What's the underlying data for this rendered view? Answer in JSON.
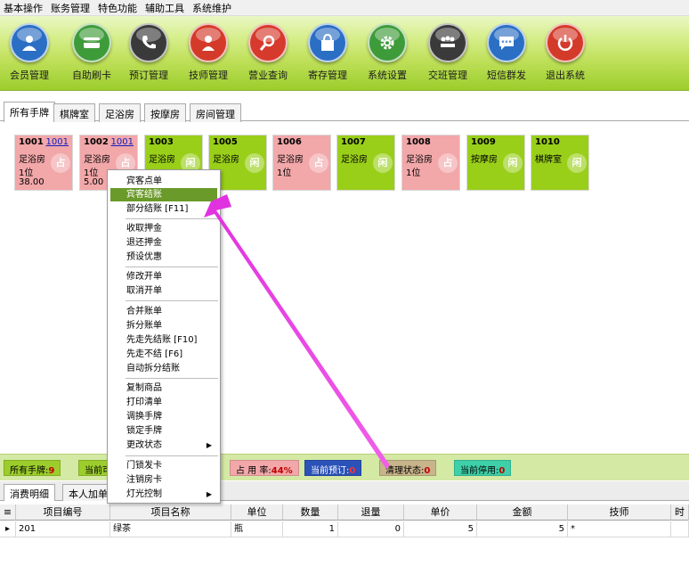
{
  "menubar": [
    "基本操作",
    "账务管理",
    "特色功能",
    "辅助工具",
    "系统维护"
  ],
  "toolbar": [
    {
      "label": "会员管理",
      "icon": "member-icon",
      "color": "#2b6fc4"
    },
    {
      "label": "自助刷卡",
      "icon": "card-icon",
      "color": "#3e9b3a"
    },
    {
      "label": "预订管理",
      "icon": "phone-icon",
      "color": "#3a3a3a"
    },
    {
      "label": "技师管理",
      "icon": "technician-icon",
      "color": "#d43a2a"
    },
    {
      "label": "营业查询",
      "icon": "magnifier-icon",
      "color": "#d63a2c"
    },
    {
      "label": "寄存管理",
      "icon": "bag-icon",
      "color": "#2b6fc4"
    },
    {
      "label": "系统设置",
      "icon": "gear-icon",
      "color": "#3e9b3a"
    },
    {
      "label": "交班管理",
      "icon": "meeting-icon",
      "color": "#3a3a3a"
    },
    {
      "label": "短信群发",
      "icon": "message-icon",
      "color": "#2b6fc4"
    },
    {
      "label": "退出系统",
      "icon": "power-icon",
      "color": "#d43a2a"
    }
  ],
  "room_tabs": [
    "所有手牌",
    "棋牌室",
    "足浴房",
    "按摩房",
    "房间管理"
  ],
  "active_room_tab": "所有手牌",
  "rooms": [
    {
      "no": "1001",
      "link": "1001",
      "type": "足浴房",
      "people": "1位",
      "amount": "38.00",
      "status": "occupied",
      "badge": "占"
    },
    {
      "no": "1002",
      "link": "1001",
      "type": "足浴房",
      "people": "1位",
      "amount": "5.00",
      "status": "occupied",
      "badge": "占"
    },
    {
      "no": "1003",
      "link": "",
      "type": "足浴房",
      "people": "",
      "amount": "",
      "status": "free",
      "badge": "闲"
    },
    {
      "no": "1005",
      "link": "",
      "type": "足浴房",
      "people": "",
      "amount": "",
      "status": "free",
      "badge": "闲"
    },
    {
      "no": "1006",
      "link": "",
      "type": "足浴房",
      "people": "1位",
      "amount": "",
      "status": "occupied",
      "badge": "占"
    },
    {
      "no": "1007",
      "link": "",
      "type": "足浴房",
      "people": "",
      "amount": "",
      "status": "free",
      "badge": "闲"
    },
    {
      "no": "1008",
      "link": "",
      "type": "足浴房",
      "people": "1位",
      "amount": "",
      "status": "occupied",
      "badge": "占"
    },
    {
      "no": "1009",
      "link": "",
      "type": "按摩房",
      "people": "",
      "amount": "",
      "status": "free",
      "badge": "闲"
    },
    {
      "no": "1010",
      "link": "",
      "type": "棋牌室",
      "people": "",
      "amount": "",
      "status": "free",
      "badge": "闲"
    }
  ],
  "status_strip": [
    {
      "label": "所有手牌:",
      "value": "9",
      "bg": "#9ccd2c",
      "color": "#c00000"
    },
    {
      "label": "当前可",
      "value": "",
      "bg": "#9ccd2c",
      "color": "#c00000"
    },
    {
      "label": "占 用 率:",
      "value": "44%",
      "bg": "#f2a7a9",
      "color": "#c00000"
    },
    {
      "label": "当前预订:",
      "value": "0",
      "bg": "#2b52b8",
      "color": "#ff3030"
    },
    {
      "label": "清理状态:",
      "value": "0",
      "bg": "#c8b48a",
      "color": "#c00000"
    },
    {
      "label": "当前停用:",
      "value": "0",
      "bg": "#3ed0a8",
      "color": "#c00000"
    }
  ],
  "detail_tabs": [
    "消费明细",
    "本人加单"
  ],
  "active_detail_tab": "消费明细",
  "grid": {
    "columns": [
      "项目编号",
      "项目名称",
      "单位",
      "数量",
      "退量",
      "单价",
      "金额",
      "技师",
      "时"
    ],
    "rows": [
      {
        "code": "201",
        "name": "绿茶",
        "unit": "瓶",
        "qty": "1",
        "ret": "0",
        "price": "5",
        "amount": "5",
        "tech": "*"
      }
    ]
  },
  "context_menu": {
    "groups": [
      [
        "宾客点单",
        "宾客结账",
        "部分结账 [F11]"
      ],
      [
        "收取押金",
        "退还押金",
        "预设优惠"
      ],
      [
        "修改开单",
        "取消开单"
      ],
      [
        "合并账单",
        "拆分账单",
        "先走先结账 [F10]",
        "先走不结 [F6]",
        "自动拆分结账"
      ],
      [
        "复制商品",
        "打印清单",
        "调换手牌",
        "锁定手牌",
        "更改状态"
      ],
      [
        "门锁发卡",
        "注销房卡",
        "灯光控制"
      ]
    ],
    "highlighted": "宾客结账",
    "with_submenu": [
      "更改状态",
      "灯光控制"
    ]
  },
  "colors": {
    "occupied": "#f2a7a9",
    "free": "#99cf19",
    "menu_highlight": "#6a9a29",
    "arrow": "#e838e0"
  }
}
